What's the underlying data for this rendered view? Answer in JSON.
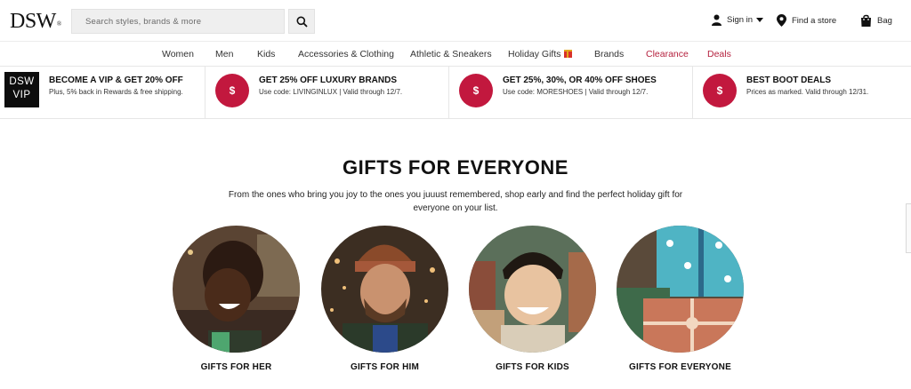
{
  "header": {
    "logo": "DSW",
    "logo_mark": "®",
    "search_placeholder": "Search styles, brands & more",
    "sign_in": "Sign in",
    "find_store": "Find a store",
    "bag": "Bag"
  },
  "nav": {
    "items": [
      "Women",
      "Men",
      "Kids",
      "Accessories & Clothing",
      "Athletic & Sneakers",
      "Holiday Gifts",
      "Brands",
      "Clearance",
      "Deals"
    ]
  },
  "promos": [
    {
      "badge_top": "DSW",
      "badge_bottom": "VIP",
      "title": "BECOME A VIP & GET 20% OFF",
      "subtitle": "Plus, 5% back in Rewards & free shipping."
    },
    {
      "icon": "$",
      "title": "GET 25% OFF LUXURY BRANDS",
      "subtitle": "Use code: LIVINGINLUX | Valid through 12/7."
    },
    {
      "icon": "$",
      "title": "GET 25%, 30%, OR 40% OFF SHOES",
      "subtitle": "Use code: MORESHOES | Valid through 12/7."
    },
    {
      "icon": "$",
      "title": "BEST BOOT DEALS",
      "subtitle": "Prices as marked. Valid through 12/31."
    }
  ],
  "hero": {
    "title": "GIFTS FOR EVERYONE",
    "description": "From the ones who bring you joy to the ones you juuust remembered, shop early and find the perfect holiday gift for everyone on your list."
  },
  "categories": [
    {
      "label": "GIFTS FOR HER"
    },
    {
      "label": "GIFTS FOR HIM"
    },
    {
      "label": "GIFTS FOR KIDS"
    },
    {
      "label": "GIFTS FOR EVERYONE"
    }
  ],
  "colors": {
    "accent_red": "#c2183e",
    "nav_red": "#b5223f",
    "vip_black": "#0d0d0d"
  }
}
